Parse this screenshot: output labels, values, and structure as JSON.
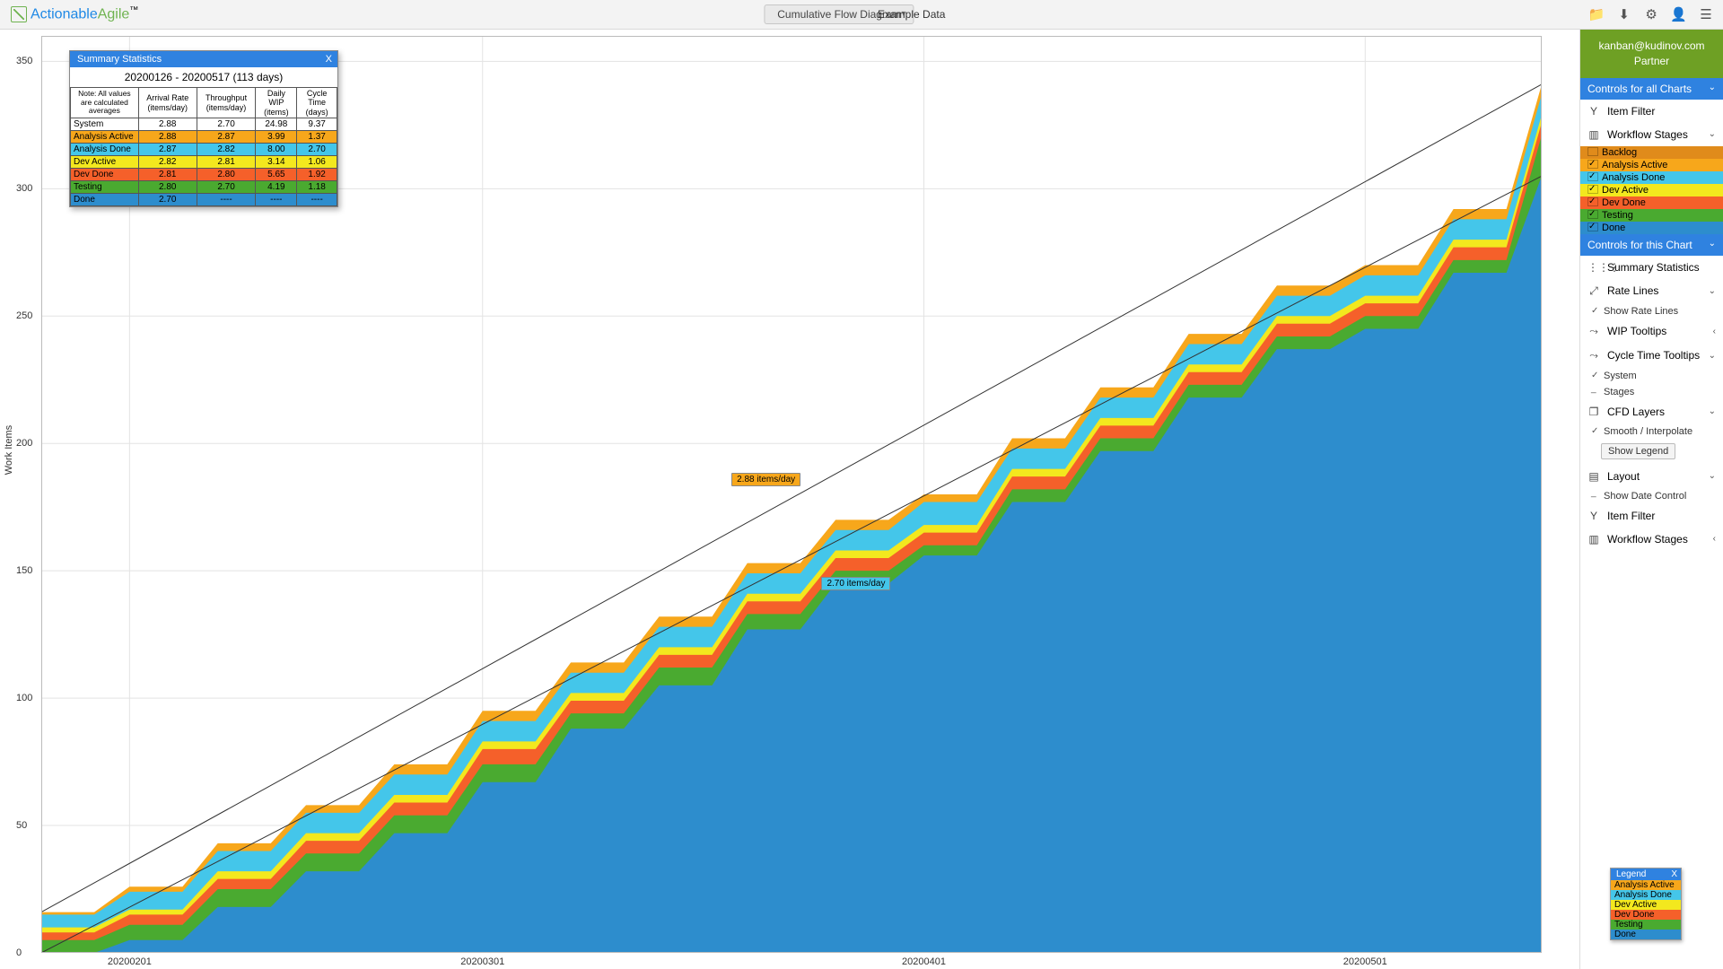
{
  "brand": {
    "a": "Actionable",
    "b": "Agile",
    "tm": "™"
  },
  "chart_selector": "Cumulative Flow Diagram",
  "data_source": "Example Data",
  "user": {
    "email": "kanban@kudinov.com",
    "role": "Partner"
  },
  "icons": {
    "folder": "📁",
    "download": "⬇",
    "settings": "⚙",
    "user": "👤",
    "menu": "☰",
    "filter": "▼",
    "columns": "▥",
    "grid": "▦",
    "line": "📈",
    "wand": "⤳",
    "layers": "❐",
    "layout": "▤"
  },
  "sec1": "Controls for all Charts",
  "sec2": "Controls for this Chart",
  "itemFilter": "Item Filter",
  "workflowStages": "Workflow Stages",
  "stages": [
    {
      "name": "Backlog",
      "checked": false,
      "color": "#e08b1b"
    },
    {
      "name": "Analysis Active",
      "checked": true,
      "color": "#f7a71b"
    },
    {
      "name": "Analysis Done",
      "checked": true,
      "color": "#44c6ea"
    },
    {
      "name": "Dev Active",
      "checked": true,
      "color": "#f3e81e"
    },
    {
      "name": "Dev Done",
      "checked": true,
      "color": "#f5602a"
    },
    {
      "name": "Testing",
      "checked": true,
      "color": "#4aaa30"
    },
    {
      "name": "Done",
      "checked": true,
      "color": "#2d8dcd"
    }
  ],
  "controls": {
    "summary": "Summary Statistics",
    "rate": "Rate Lines",
    "rateSub": "Show Rate Lines",
    "wip": "WIP Tooltips",
    "ct": "Cycle Time Tooltips",
    "ctSub1": "System",
    "ctSub2": "Stages",
    "layers": "CFD Layers",
    "layersSub": "Smooth / Interpolate",
    "layersBtn": "Show Legend",
    "layout": "Layout",
    "layoutSub": "Show Date Control"
  },
  "ylabel": "Work Items",
  "rate1": "2.88 items/day",
  "rate2": "2.70 items/day",
  "stats": {
    "title": "Summary Statistics",
    "range": "20200126 - 20200517 (113 days)",
    "note": "Note: All values are calculated averages",
    "cols": [
      "Arrival Rate (items/day)",
      "Throughput (items/day)",
      "Daily WIP (items)",
      "Cycle Time (days)"
    ],
    "rows": [
      {
        "name": "System",
        "vals": [
          "2.88",
          "2.70",
          "24.98",
          "9.37"
        ],
        "color": "#ffffff"
      },
      {
        "name": "Analysis Active",
        "vals": [
          "2.88",
          "2.87",
          "3.99",
          "1.37"
        ],
        "color": "#f7a71b"
      },
      {
        "name": "Analysis Done",
        "vals": [
          "2.87",
          "2.82",
          "8.00",
          "2.70"
        ],
        "color": "#44c6ea"
      },
      {
        "name": "Dev Active",
        "vals": [
          "2.82",
          "2.81",
          "3.14",
          "1.06"
        ],
        "color": "#f3e81e"
      },
      {
        "name": "Dev Done",
        "vals": [
          "2.81",
          "2.80",
          "5.65",
          "1.92"
        ],
        "color": "#f5602a"
      },
      {
        "name": "Testing",
        "vals": [
          "2.80",
          "2.70",
          "4.19",
          "1.18"
        ],
        "color": "#4aaa30"
      },
      {
        "name": "Done",
        "vals": [
          "2.70",
          "----",
          "----",
          "----"
        ],
        "color": "#2d8dcd"
      }
    ]
  },
  "legend": {
    "title": "Legend",
    "rows": [
      {
        "name": "Analysis Active",
        "color": "#f7a71b"
      },
      {
        "name": "Analysis Done",
        "color": "#44c6ea"
      },
      {
        "name": "Dev Active",
        "color": "#f3e81e"
      },
      {
        "name": "Dev Done",
        "color": "#f5602a"
      },
      {
        "name": "Testing",
        "color": "#4aaa30"
      },
      {
        "name": "Done",
        "color": "#2d8dcd"
      }
    ]
  },
  "chart_data": {
    "type": "area",
    "xlabel": "",
    "ylabel": "Work Items",
    "ylim": [
      0,
      360
    ],
    "x_ticks": [
      "20200201",
      "20200301",
      "20200401",
      "20200501"
    ],
    "y_ticks": [
      0,
      50,
      100,
      150,
      200,
      250,
      300,
      350
    ],
    "dates": [
      "20200126",
      "20200201",
      "20200208",
      "20200215",
      "20200222",
      "20200301",
      "20200308",
      "20200315",
      "20200322",
      "20200329",
      "20200401",
      "20200408",
      "20200415",
      "20200422",
      "20200429",
      "20200501",
      "20200508",
      "20200517"
    ],
    "series": [
      {
        "name": "Analysis Active",
        "color": "#f7a71b",
        "values": [
          16,
          26,
          43,
          58,
          74,
          95,
          114,
          132,
          153,
          170,
          180,
          202,
          222,
          243,
          262,
          270,
          292,
          341
        ]
      },
      {
        "name": "Analysis Done",
        "color": "#44c6ea",
        "values": [
          15,
          24,
          40,
          55,
          70,
          91,
          110,
          128,
          149,
          166,
          177,
          198,
          218,
          239,
          258,
          266,
          288,
          337
        ]
      },
      {
        "name": "Dev Active",
        "color": "#f3e81e",
        "values": [
          10,
          17,
          32,
          47,
          62,
          83,
          102,
          120,
          141,
          158,
          168,
          190,
          210,
          231,
          250,
          258,
          280,
          329
        ]
      },
      {
        "name": "Dev Done",
        "color": "#f5602a",
        "values": [
          8,
          15,
          29,
          44,
          59,
          80,
          99,
          117,
          138,
          155,
          165,
          187,
          207,
          228,
          247,
          255,
          277,
          326
        ]
      },
      {
        "name": "Testing",
        "color": "#4aaa30",
        "values": [
          5,
          11,
          25,
          39,
          54,
          74,
          94,
          112,
          133,
          150,
          160,
          182,
          202,
          223,
          242,
          250,
          272,
          321
        ]
      },
      {
        "name": "Done",
        "color": "#2d8dcd",
        "values": [
          0,
          5,
          18,
          32,
          47,
          67,
          88,
          105,
          127,
          145,
          156,
          177,
          197,
          218,
          237,
          245,
          267,
          305
        ]
      }
    ],
    "rate_lines": [
      {
        "label": "2.88 items/day",
        "from": [
          "20200126",
          16
        ],
        "to": [
          "20200517",
          341
        ]
      },
      {
        "label": "2.70 items/day",
        "from": [
          "20200126",
          0
        ],
        "to": [
          "20200517",
          305
        ]
      }
    ]
  }
}
